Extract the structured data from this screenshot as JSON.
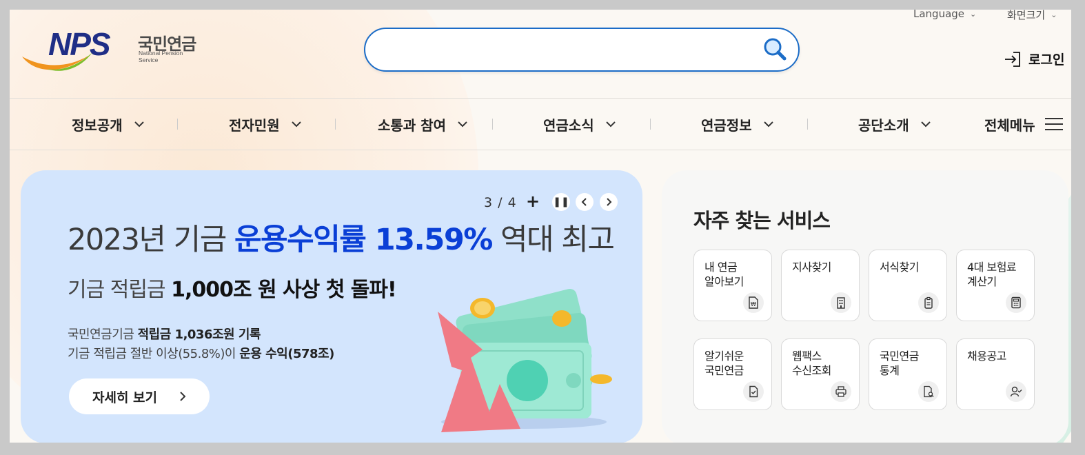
{
  "header": {
    "language_label": "Language",
    "screen_size_label": "화면크기",
    "logo": {
      "wordmark": "NPS",
      "korean": "국민연금",
      "english": "National Pension Service"
    },
    "search": {
      "value": "",
      "placeholder": ""
    },
    "login_label": "로그인"
  },
  "nav": {
    "items": [
      {
        "label": "정보공개"
      },
      {
        "label": "전자민원"
      },
      {
        "label": "소통과 참여"
      },
      {
        "label": "연금소식"
      },
      {
        "label": "연금정보"
      },
      {
        "label": "공단소개"
      }
    ],
    "all_menu_label": "전체메뉴"
  },
  "banner": {
    "counter": "3 / 4",
    "title_prefix": "2023년 기금 ",
    "title_highlight": "운용수익률 13.59%",
    "title_suffix": " 역대 최고",
    "sub_prefix": "기금 적립금 ",
    "sub_bold": "1,000조 원 사상 첫 돌파!",
    "line1_prefix": "국민연금기금 ",
    "line1_bold": "적립금 1,036조원 기록",
    "line2_prefix": "기금 적립금 절반 이상(55.8%)이 ",
    "line2_bold": "운용 수익(578조)",
    "more_label": "자세히 보기",
    "background_color": "#d3e5fd",
    "highlight_color": "#0a3fd6"
  },
  "services": {
    "title": "자주 찾는 서비스",
    "cards": [
      {
        "line1": "내 연금",
        "line2": "알아보기",
        "icon": "pension-won-doc-icon"
      },
      {
        "line1": "지사찾기",
        "line2": "",
        "icon": "building-icon"
      },
      {
        "line1": "서식찾기",
        "line2": "",
        "icon": "clipboard-icon"
      },
      {
        "line1": "4대 보험료",
        "line2": "계산기",
        "icon": "calculator-icon"
      },
      {
        "line1": "알기쉬운",
        "line2": "국민연금",
        "icon": "document-check-icon"
      },
      {
        "line1": "웹팩스",
        "line2": "수신조회",
        "icon": "printer-icon"
      },
      {
        "line1": "국민연금",
        "line2": "통계",
        "icon": "document-search-icon"
      },
      {
        "line1": "채용공고",
        "line2": "",
        "icon": "person-check-icon"
      }
    ]
  },
  "colors": {
    "brand_navy": "#1f2e86",
    "search_border": "#1b6cc7"
  }
}
